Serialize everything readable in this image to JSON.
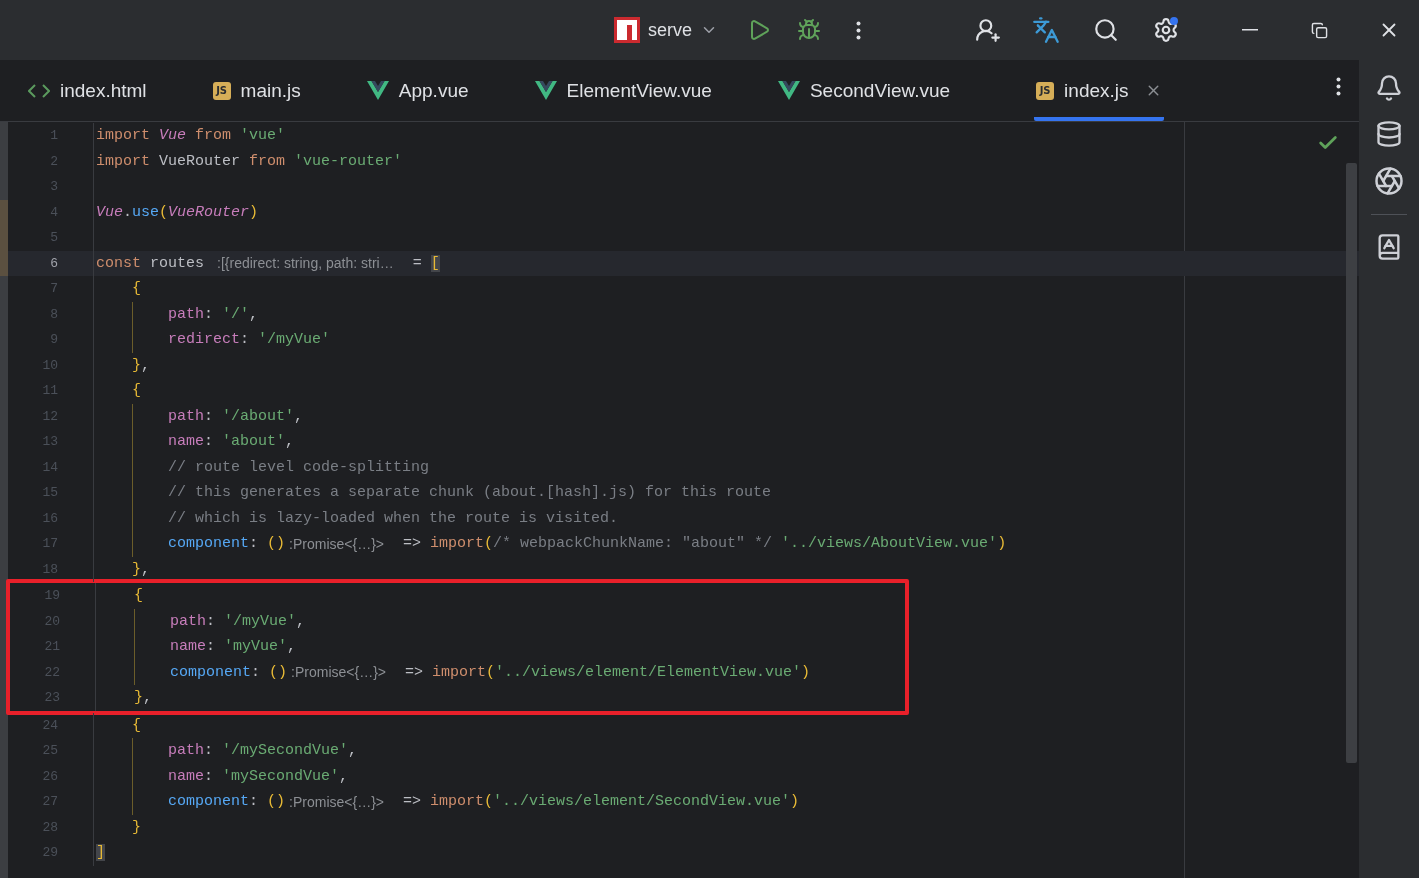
{
  "titlebar": {
    "run_config": "serve"
  },
  "tabs": [
    {
      "label": "index.html",
      "kind": "html",
      "selected": false
    },
    {
      "label": "main.js",
      "kind": "js",
      "badge": "JS",
      "selected": false
    },
    {
      "label": "App.vue",
      "kind": "vue",
      "selected": false
    },
    {
      "label": "ElementView.vue",
      "kind": "vue",
      "selected": false
    },
    {
      "label": "SecondView.vue",
      "kind": "vue",
      "selected": false
    },
    {
      "label": "index.js",
      "kind": "js",
      "badge": "JS",
      "selected": true
    }
  ],
  "code": {
    "lines": [
      {
        "number": "1",
        "tokens": [
          {
            "text": "import ",
            "kind": "kw"
          },
          {
            "text": "Vue",
            "kind": "cls"
          },
          {
            "text": " from ",
            "kind": "kw"
          },
          {
            "text": "'vue'",
            "kind": "str"
          }
        ]
      },
      {
        "number": "2",
        "tokens": [
          {
            "text": "import ",
            "kind": "kw"
          },
          {
            "text": "VueRouter ",
            "kind": "plain"
          },
          {
            "text": "from ",
            "kind": "kw"
          },
          {
            "text": "'vue-router'",
            "kind": "str"
          }
        ]
      },
      {
        "number": "3"
      },
      {
        "number": "4",
        "changed": true,
        "tokens": [
          {
            "text": "Vue",
            "kind": "cls"
          },
          {
            "text": ".",
            "kind": "plain"
          },
          {
            "text": "use",
            "kind": "fn"
          },
          {
            "text": "(",
            "kind": "paren"
          },
          {
            "text": "VueRouter",
            "kind": "cls"
          },
          {
            "text": ")",
            "kind": "paren"
          }
        ]
      },
      {
        "number": "5",
        "changed": true
      },
      {
        "number": "6",
        "changed": true,
        "current": true,
        "tokens": [
          {
            "text": "const ",
            "kind": "kw"
          },
          {
            "text": "routes ",
            "kind": "plain"
          },
          {
            "text": ":[{redirect: string, path: stri…",
            "kind": "hint"
          },
          {
            "text": " = ",
            "kind": "plain"
          },
          {
            "text": "[",
            "kind": "match"
          }
        ]
      },
      {
        "number": "7",
        "tokens": [
          {
            "text": "    {",
            "kind": "paren"
          }
        ]
      },
      {
        "number": "8",
        "tokens": [
          {
            "text": "        path",
            "kind": "prop"
          },
          {
            "text": ": ",
            "kind": "plain"
          },
          {
            "text": "'/'",
            "kind": "str"
          },
          {
            "text": ",",
            "kind": "plain"
          }
        ]
      },
      {
        "number": "9",
        "tokens": [
          {
            "text": "        redirect",
            "kind": "prop"
          },
          {
            "text": ": ",
            "kind": "plain"
          },
          {
            "text": "'/myVue'",
            "kind": "str"
          }
        ]
      },
      {
        "number": "10",
        "tokens": [
          {
            "text": "    }",
            "kind": "paren"
          },
          {
            "text": ",",
            "kind": "plain"
          }
        ]
      },
      {
        "number": "11",
        "tokens": [
          {
            "text": "    {",
            "kind": "paren"
          }
        ]
      },
      {
        "number": "12",
        "tokens": [
          {
            "text": "        path",
            "kind": "prop"
          },
          {
            "text": ": ",
            "kind": "plain"
          },
          {
            "text": "'/about'",
            "kind": "str"
          },
          {
            "text": ",",
            "kind": "plain"
          }
        ]
      },
      {
        "number": "13",
        "tokens": [
          {
            "text": "        name",
            "kind": "prop"
          },
          {
            "text": ": ",
            "kind": "plain"
          },
          {
            "text": "'about'",
            "kind": "str"
          },
          {
            "text": ",",
            "kind": "plain"
          }
        ]
      },
      {
        "number": "14",
        "tokens": [
          {
            "text": "        // route level code-splitting",
            "kind": "comment"
          }
        ]
      },
      {
        "number": "15",
        "tokens": [
          {
            "text": "        // this generates a separate chunk (about.[hash].js) for this route",
            "kind": "comment"
          }
        ]
      },
      {
        "number": "16",
        "tokens": [
          {
            "text": "        // which is lazy-loaded when the route is visited.",
            "kind": "comment"
          }
        ]
      },
      {
        "number": "17",
        "tokens": [
          {
            "text": "        component",
            "kind": "fn"
          },
          {
            "text": ": ",
            "kind": "plain"
          },
          {
            "text": "()",
            "kind": "paren"
          },
          {
            "text": ":Promise<{…}>",
            "kind": "hint"
          },
          {
            "text": " => ",
            "kind": "plain"
          },
          {
            "text": "import",
            "kind": "kw"
          },
          {
            "text": "(",
            "kind": "paren"
          },
          {
            "text": "/* webpackChunkName: \"about\" */",
            "kind": "comment"
          },
          {
            "text": " '../views/AboutView.vue'",
            "kind": "str"
          },
          {
            "text": ")",
            "kind": "paren"
          }
        ]
      },
      {
        "number": "18",
        "tokens": [
          {
            "text": "    }",
            "kind": "paren"
          },
          {
            "text": ",",
            "kind": "plain"
          }
        ]
      },
      {
        "number": "19",
        "boxed": true,
        "tokens": [
          {
            "text": "    {",
            "kind": "paren"
          }
        ]
      },
      {
        "number": "20",
        "boxed": true,
        "tokens": [
          {
            "text": "        path",
            "kind": "prop"
          },
          {
            "text": ": ",
            "kind": "plain"
          },
          {
            "text": "'/myVue'",
            "kind": "str"
          },
          {
            "text": ",",
            "kind": "plain"
          }
        ]
      },
      {
        "number": "21",
        "boxed": true,
        "tokens": [
          {
            "text": "        name",
            "kind": "prop"
          },
          {
            "text": ": ",
            "kind": "plain"
          },
          {
            "text": "'myVue'",
            "kind": "str"
          },
          {
            "text": ",",
            "kind": "plain"
          }
        ]
      },
      {
        "number": "22",
        "boxed": true,
        "tokens": [
          {
            "text": "        component",
            "kind": "fn"
          },
          {
            "text": ": ",
            "kind": "plain"
          },
          {
            "text": "()",
            "kind": "paren"
          },
          {
            "text": ":Promise<{…}>",
            "kind": "hint"
          },
          {
            "text": " => ",
            "kind": "plain"
          },
          {
            "text": "import",
            "kind": "kw"
          },
          {
            "text": "(",
            "kind": "paren"
          },
          {
            "text": "'../views/element/ElementView.vue'",
            "kind": "str"
          },
          {
            "text": ")",
            "kind": "paren"
          }
        ]
      },
      {
        "number": "23",
        "boxed": true,
        "tokens": [
          {
            "text": "    }",
            "kind": "paren"
          },
          {
            "text": ",",
            "kind": "plain"
          }
        ]
      },
      {
        "number": "24",
        "tokens": [
          {
            "text": "    {",
            "kind": "paren"
          }
        ]
      },
      {
        "number": "25",
        "tokens": [
          {
            "text": "        path",
            "kind": "prop"
          },
          {
            "text": ": ",
            "kind": "plain"
          },
          {
            "text": "'/mySecondVue'",
            "kind": "str"
          },
          {
            "text": ",",
            "kind": "plain"
          }
        ]
      },
      {
        "number": "26",
        "tokens": [
          {
            "text": "        name",
            "kind": "prop"
          },
          {
            "text": ": ",
            "kind": "plain"
          },
          {
            "text": "'mySecondVue'",
            "kind": "str"
          },
          {
            "text": ",",
            "kind": "plain"
          }
        ]
      },
      {
        "number": "27",
        "tokens": [
          {
            "text": "        component",
            "kind": "fn"
          },
          {
            "text": ": ",
            "kind": "plain"
          },
          {
            "text": "()",
            "kind": "paren"
          },
          {
            "text": ":Promise<{…}>",
            "kind": "hint"
          },
          {
            "text": " => ",
            "kind": "plain"
          },
          {
            "text": "import",
            "kind": "kw"
          },
          {
            "text": "(",
            "kind": "paren"
          },
          {
            "text": "'../views/element/SecondView.vue'",
            "kind": "str"
          },
          {
            "text": ")",
            "kind": "paren"
          }
        ]
      },
      {
        "number": "28",
        "tokens": [
          {
            "text": "    }",
            "kind": "paren"
          }
        ]
      },
      {
        "number": "29",
        "tokens": [
          {
            "text": "]",
            "kind": "match"
          }
        ]
      }
    ]
  }
}
